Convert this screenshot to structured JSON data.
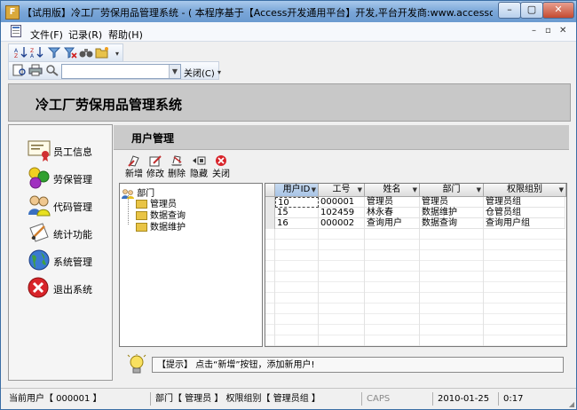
{
  "window": {
    "title": "【试用版】冷工厂劳保用品管理系统 - ( 本程序基于【Access开发通用平台】开发,平台开发商:www.accessoft.com ) - [控...",
    "minimize_glyph": "–",
    "maximize_glyph": "▢",
    "close_glyph": "✕"
  },
  "menubar": {
    "items": [
      "文件(F)",
      "记录(R)",
      "帮助(H)"
    ],
    "mdi_controls": [
      "–",
      "▫",
      "✕"
    ]
  },
  "toolbar": {
    "close_label": "关闭(C)",
    "filter_placeholder": ""
  },
  "banner": {
    "title": "冷工厂劳保用品管理系统"
  },
  "nav": {
    "items": [
      {
        "label": "员工信息",
        "icon": "certificate-icon"
      },
      {
        "label": "劳保管理",
        "icon": "colored-balls-icon"
      },
      {
        "label": "代码管理",
        "icon": "people-icon"
      },
      {
        "label": "统计功能",
        "icon": "writing-icon"
      },
      {
        "label": "系统管理",
        "icon": "globe-icon"
      },
      {
        "label": "退出系统",
        "icon": "exit-icon"
      }
    ]
  },
  "page": {
    "title": "用户管理",
    "actions": [
      {
        "label": "新增",
        "icon": "new-icon"
      },
      {
        "label": "修改",
        "icon": "edit-icon"
      },
      {
        "label": "删除",
        "icon": "delete-icon"
      },
      {
        "label": "隐藏",
        "icon": "hide-icon"
      },
      {
        "label": "关闭",
        "icon": "close-icon"
      }
    ]
  },
  "tree": {
    "root": "部门",
    "children": [
      "管理员",
      "数据查询",
      "数据维护"
    ]
  },
  "grid": {
    "columns": [
      "用户ID",
      "工号",
      "姓名",
      "部门",
      "权限组别"
    ],
    "rows": [
      [
        "10",
        "000001",
        "管理员",
        "管理员",
        "管理员组"
      ],
      [
        "15",
        "102459",
        "林永春",
        "数据维护",
        "仓管员组"
      ],
      [
        "16",
        "000002",
        "查询用户",
        "数据查询",
        "查询用户组"
      ]
    ]
  },
  "hint": {
    "text": "【提示】 点击“新增”按钮，添加新用户!"
  },
  "status": {
    "current_user": "当前用户【 000001 】",
    "dept_group": "部门【 管理员 】 权限组别【 管理员组 】",
    "caps": "CAPS",
    "date": "2010-01-25",
    "time": "0:17"
  },
  "colors": {
    "title_gradient_top": "#a9c9ec",
    "title_gradient_bottom": "#6b9bd0",
    "banner": "#c8c8c8",
    "close_red": "#d8242a"
  }
}
